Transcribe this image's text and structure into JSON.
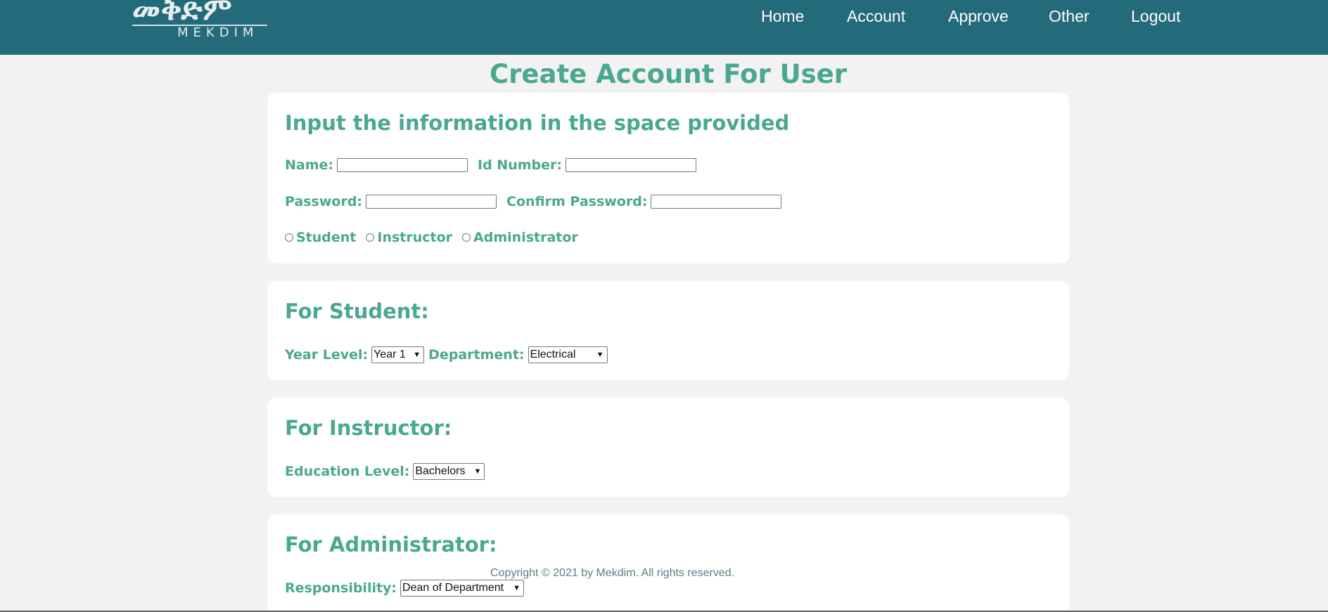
{
  "header": {
    "logo_text": "መቅድም",
    "logo_subtitle": "MEKDIM",
    "nav": [
      "Home",
      "Account",
      "Approve",
      "Other",
      "Logout"
    ]
  },
  "page_title": "Create Account For User",
  "general": {
    "heading": "Input the information in the space provided",
    "name_label": "Name:",
    "id_label": "Id Number:",
    "password_label": "Password:",
    "confirm_label": "Confirm Password:",
    "roles": [
      "Student",
      "Instructor",
      "Administrator"
    ]
  },
  "student": {
    "heading": "For Student:",
    "year_label": "Year Level:",
    "year_value": "Year 1",
    "department_label": "Department:",
    "department_value": "Electrical"
  },
  "instructor": {
    "heading": "For Instructor:",
    "education_label": "Education Level:",
    "education_value": "Bachelors"
  },
  "administrator": {
    "heading": "For Administrator:",
    "responsibility_label": "Responsibility:",
    "responsibility_value": "Dean of Department"
  },
  "footer": {
    "copyright": "Copyright © 2021 by Mekdim. All rights reserved."
  },
  "colors": {
    "header_bg": "#236a7a",
    "accent": "#4aa890",
    "page_bg": "#f2f2f2"
  }
}
